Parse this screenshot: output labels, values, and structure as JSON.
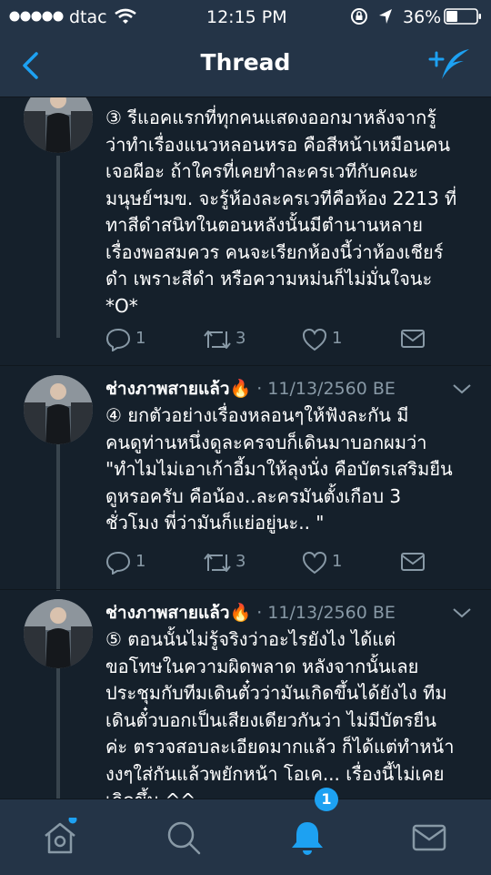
{
  "status_bar": {
    "carrier": "dtac",
    "time": "12:15 PM",
    "battery": "36%"
  },
  "nav": {
    "title": "Thread"
  },
  "tweets": [
    {
      "name": "",
      "meta": "",
      "lines": [
        "③  รีแอคแรกที่ทุกคนแสดงออกมาหลังจากรู้",
        "ว่าทำเรื่องแนวหลอนหรอ คือสีหน้าเหมือนคน",
        "เจอผีอะ ถ้าใครที่เคยทำละครเวทีกับคณะ",
        "มนุษย์ฯมข. จะรู้ห้องละครเวทีคือห้อง 2213 ที่",
        "ทาสีดำสนิทในตอนหลังนั้นมีตำนานหลาย",
        "เรื่องพอสมควร คนจะเรียกห้องนี้ว่าห้องเชียร์",
        "ดำ เพราะสีดำ หรือความหม่นก็ไม่มั่นใจนะ",
        "*O*"
      ],
      "replies": "1",
      "retweets": "3",
      "likes": "1"
    },
    {
      "name": "ช่างภาพสายแล้ว🔥",
      "meta": " · 11/13/2560 BE",
      "lines": [
        "④   ยกตัวอย่างเรื่องหลอนๆให้ฟังละกัน มี",
        "คนดูท่านหนึ่งดูละครจบก็เดินมาบอกผมว่า",
        "\"ทำไมไม่เอาเก้าอี้มาให้ลุงนั่ง คือบัตรเสริมยืน",
        "ดูหรอครับ คือน้อง..ละครมันตั้งเกือบ 3",
        "ชั่วโมง พี่ว่ามันก็แย่อยู่นะ.. \""
      ],
      "replies": "1",
      "retweets": "3",
      "likes": "1"
    },
    {
      "name": "ช่างภาพสายแล้ว🔥",
      "meta": " · 11/13/2560 BE",
      "lines": [
        "⑤   ตอนนั้นไม่รู้จริงว่าอะไรยังไง ได้แต่",
        "ขอโทษในความผิดพลาด หลังจากนั้นเลย",
        "ประชุมกับทีมเดินตั๋วว่ามันเกิดขึ้นได้ยังไง ทีม",
        "เดินตั๋วบอกเป็นเสียงเดียวกันว่า ไม่มีบัตรยืน",
        "ค่ะ ตรวจสอบละเอียดมากแล้ว ก็ได้แต่ทำหน้า",
        "งงๆใส่กันแล้วพยักหน้า โอเค... เรื่องนี้ไม่เคย",
        "เกิดขึ้น ^^"
      ]
    }
  ],
  "tab_bar": {
    "items": [
      "home",
      "search",
      "notifications",
      "messages"
    ],
    "notification_count": "1"
  },
  "colors": {
    "background": "#15202b",
    "bar": "#243447",
    "accent": "#1da1f2",
    "muted": "#8899a6"
  }
}
